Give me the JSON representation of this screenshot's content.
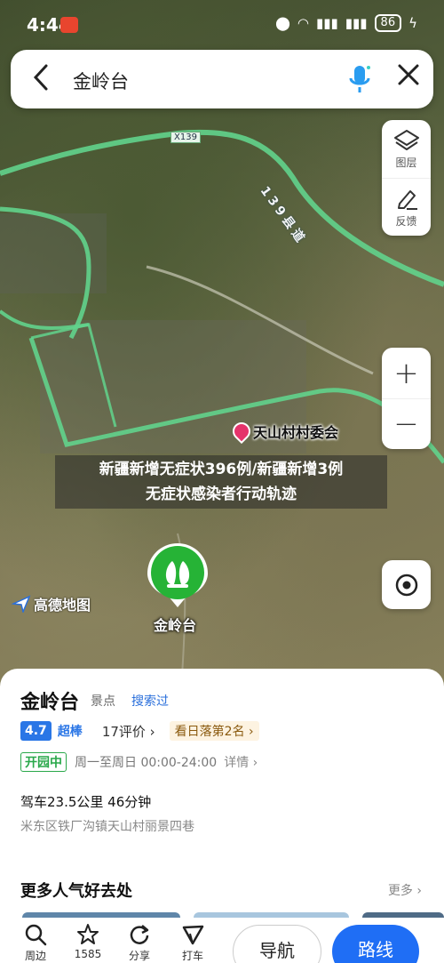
{
  "status": {
    "time": "4:44",
    "battery": "86"
  },
  "search": {
    "query": "金岭台"
  },
  "map_controls": {
    "layers_label": "图层",
    "feedback_label": "反馈",
    "zoom_in": "+",
    "zoom_out": "−"
  },
  "map": {
    "road_badge": "X139",
    "road_name": "139县道",
    "poi_label": "天山村村委会",
    "marker_label": "金岭台",
    "logo_text": "高德地图",
    "overlay_title_line1": "新疆新增无症状396例/新疆新增3例",
    "overlay_title_line2": "无症状感染者行动轨迹"
  },
  "place": {
    "name": "金岭台",
    "category": "景点",
    "searched": "搜索过",
    "score": "4.7",
    "score_word": "超棒",
    "reviews": "17评价 ›",
    "rank": "看日落第2名 ›",
    "open_status": "开园中",
    "hours": "周一至周日 00:00-24:00",
    "details": "详情 ›",
    "drive": "驾车23.5公里 46分钟",
    "address": "米东区铁厂沟镇天山村丽景四巷"
  },
  "popular": {
    "title": "更多人气好去处",
    "more": "更多 ›"
  },
  "toolbar": {
    "nearby": "周边",
    "favorite": "1585",
    "share": "分享",
    "checkin": "打车",
    "navigate": "导航",
    "route": "路线"
  },
  "colors": {
    "accent": "#1f6ef5",
    "road": "#5fd08a",
    "open": "#29a84a",
    "marker": "#26b336"
  }
}
